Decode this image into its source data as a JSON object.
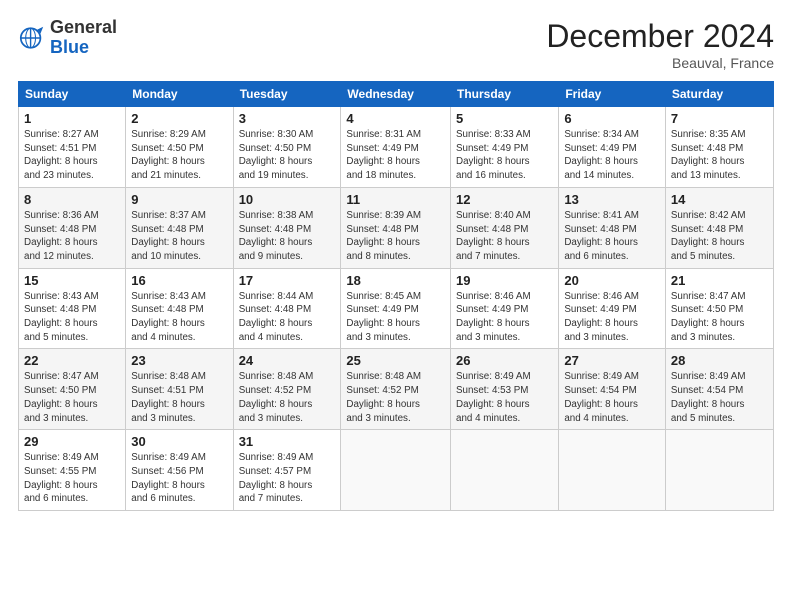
{
  "logo": {
    "line1": "General",
    "line2": "Blue"
  },
  "title": "December 2024",
  "location": "Beauval, France",
  "weekdays": [
    "Sunday",
    "Monday",
    "Tuesday",
    "Wednesday",
    "Thursday",
    "Friday",
    "Saturday"
  ],
  "weeks": [
    [
      {
        "day": "1",
        "info": "Sunrise: 8:27 AM\nSunset: 4:51 PM\nDaylight: 8 hours\nand 23 minutes."
      },
      {
        "day": "2",
        "info": "Sunrise: 8:29 AM\nSunset: 4:50 PM\nDaylight: 8 hours\nand 21 minutes."
      },
      {
        "day": "3",
        "info": "Sunrise: 8:30 AM\nSunset: 4:50 PM\nDaylight: 8 hours\nand 19 minutes."
      },
      {
        "day": "4",
        "info": "Sunrise: 8:31 AM\nSunset: 4:49 PM\nDaylight: 8 hours\nand 18 minutes."
      },
      {
        "day": "5",
        "info": "Sunrise: 8:33 AM\nSunset: 4:49 PM\nDaylight: 8 hours\nand 16 minutes."
      },
      {
        "day": "6",
        "info": "Sunrise: 8:34 AM\nSunset: 4:49 PM\nDaylight: 8 hours\nand 14 minutes."
      },
      {
        "day": "7",
        "info": "Sunrise: 8:35 AM\nSunset: 4:48 PM\nDaylight: 8 hours\nand 13 minutes."
      }
    ],
    [
      {
        "day": "8",
        "info": "Sunrise: 8:36 AM\nSunset: 4:48 PM\nDaylight: 8 hours\nand 12 minutes."
      },
      {
        "day": "9",
        "info": "Sunrise: 8:37 AM\nSunset: 4:48 PM\nDaylight: 8 hours\nand 10 minutes."
      },
      {
        "day": "10",
        "info": "Sunrise: 8:38 AM\nSunset: 4:48 PM\nDaylight: 8 hours\nand 9 minutes."
      },
      {
        "day": "11",
        "info": "Sunrise: 8:39 AM\nSunset: 4:48 PM\nDaylight: 8 hours\nand 8 minutes."
      },
      {
        "day": "12",
        "info": "Sunrise: 8:40 AM\nSunset: 4:48 PM\nDaylight: 8 hours\nand 7 minutes."
      },
      {
        "day": "13",
        "info": "Sunrise: 8:41 AM\nSunset: 4:48 PM\nDaylight: 8 hours\nand 6 minutes."
      },
      {
        "day": "14",
        "info": "Sunrise: 8:42 AM\nSunset: 4:48 PM\nDaylight: 8 hours\nand 5 minutes."
      }
    ],
    [
      {
        "day": "15",
        "info": "Sunrise: 8:43 AM\nSunset: 4:48 PM\nDaylight: 8 hours\nand 5 minutes."
      },
      {
        "day": "16",
        "info": "Sunrise: 8:43 AM\nSunset: 4:48 PM\nDaylight: 8 hours\nand 4 minutes."
      },
      {
        "day": "17",
        "info": "Sunrise: 8:44 AM\nSunset: 4:48 PM\nDaylight: 8 hours\nand 4 minutes."
      },
      {
        "day": "18",
        "info": "Sunrise: 8:45 AM\nSunset: 4:49 PM\nDaylight: 8 hours\nand 3 minutes."
      },
      {
        "day": "19",
        "info": "Sunrise: 8:46 AM\nSunset: 4:49 PM\nDaylight: 8 hours\nand 3 minutes."
      },
      {
        "day": "20",
        "info": "Sunrise: 8:46 AM\nSunset: 4:49 PM\nDaylight: 8 hours\nand 3 minutes."
      },
      {
        "day": "21",
        "info": "Sunrise: 8:47 AM\nSunset: 4:50 PM\nDaylight: 8 hours\nand 3 minutes."
      }
    ],
    [
      {
        "day": "22",
        "info": "Sunrise: 8:47 AM\nSunset: 4:50 PM\nDaylight: 8 hours\nand 3 minutes."
      },
      {
        "day": "23",
        "info": "Sunrise: 8:48 AM\nSunset: 4:51 PM\nDaylight: 8 hours\nand 3 minutes."
      },
      {
        "day": "24",
        "info": "Sunrise: 8:48 AM\nSunset: 4:52 PM\nDaylight: 8 hours\nand 3 minutes."
      },
      {
        "day": "25",
        "info": "Sunrise: 8:48 AM\nSunset: 4:52 PM\nDaylight: 8 hours\nand 3 minutes."
      },
      {
        "day": "26",
        "info": "Sunrise: 8:49 AM\nSunset: 4:53 PM\nDaylight: 8 hours\nand 4 minutes."
      },
      {
        "day": "27",
        "info": "Sunrise: 8:49 AM\nSunset: 4:54 PM\nDaylight: 8 hours\nand 4 minutes."
      },
      {
        "day": "28",
        "info": "Sunrise: 8:49 AM\nSunset: 4:54 PM\nDaylight: 8 hours\nand 5 minutes."
      }
    ],
    [
      {
        "day": "29",
        "info": "Sunrise: 8:49 AM\nSunset: 4:55 PM\nDaylight: 8 hours\nand 6 minutes."
      },
      {
        "day": "30",
        "info": "Sunrise: 8:49 AM\nSunset: 4:56 PM\nDaylight: 8 hours\nand 6 minutes."
      },
      {
        "day": "31",
        "info": "Sunrise: 8:49 AM\nSunset: 4:57 PM\nDaylight: 8 hours\nand 7 minutes."
      },
      null,
      null,
      null,
      null
    ]
  ]
}
